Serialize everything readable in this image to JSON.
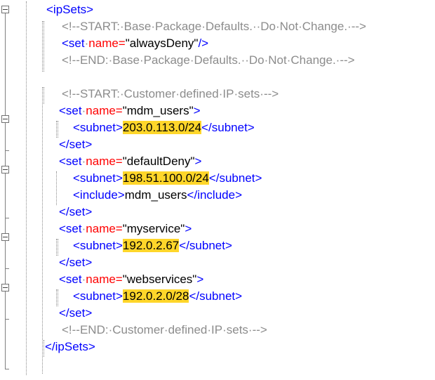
{
  "editor": {
    "lines": [
      {
        "name": "ipsets-open",
        "parts": [
          {
            "t": "tag",
            "v": "<ipSets>"
          }
        ]
      },
      {
        "name": "comment-start-base",
        "parts": [
          {
            "t": "cmt",
            "v": "<!--START:·Base·Package·Defaults.··Do·Not·Change.·-->"
          }
        ]
      },
      {
        "name": "set-alwaysdeny",
        "parts": [
          {
            "t": "tag",
            "v": "<set"
          },
          {
            "t": "cmt",
            "v": "·"
          },
          {
            "t": "attr",
            "v": "name="
          },
          {
            "t": "val",
            "v": "\"alwaysDeny\""
          },
          {
            "t": "tag",
            "v": "/>"
          }
        ]
      },
      {
        "name": "comment-end-base",
        "parts": [
          {
            "t": "cmt",
            "v": "<!--END:·Base·Package·Defaults.··Do·Not·Change.·-->"
          }
        ]
      },
      {
        "name": "blank",
        "parts": []
      },
      {
        "name": "comment-start-customer",
        "parts": [
          {
            "t": "cmt",
            "v": "<!--START:·Customer·defined·IP·sets·-->"
          }
        ]
      },
      {
        "name": "set-mdm-users",
        "parts": [
          {
            "t": "tag",
            "v": "<set"
          },
          {
            "t": "cmt",
            "v": "·"
          },
          {
            "t": "attr",
            "v": "name="
          },
          {
            "t": "val",
            "v": "\"mdm_users\""
          },
          {
            "t": "tag",
            "v": ">"
          }
        ]
      },
      {
        "name": "subnet-mdm",
        "parts": [
          {
            "t": "tag",
            "v": "<subnet>"
          },
          {
            "t": "hl",
            "v": "203.0.113.0/24"
          },
          {
            "t": "tag",
            "v": "</subnet>"
          }
        ]
      },
      {
        "name": "set-close",
        "parts": [
          {
            "t": "tag",
            "v": "</set>"
          }
        ]
      },
      {
        "name": "set-defaultdeny",
        "parts": [
          {
            "t": "tag",
            "v": "<set"
          },
          {
            "t": "cmt",
            "v": "·"
          },
          {
            "t": "attr",
            "v": "name="
          },
          {
            "t": "val",
            "v": "\"defaultDeny\""
          },
          {
            "t": "tag",
            "v": ">"
          }
        ]
      },
      {
        "name": "subnet-defaultdeny",
        "parts": [
          {
            "t": "tag",
            "v": "<subnet>"
          },
          {
            "t": "hl",
            "v": "198.51.100.0/24"
          },
          {
            "t": "tag",
            "v": "</subnet>"
          }
        ]
      },
      {
        "name": "include-mdm",
        "parts": [
          {
            "t": "tag",
            "v": "<include>"
          },
          {
            "t": "txt",
            "v": "mdm_users"
          },
          {
            "t": "tag",
            "v": "</include>"
          }
        ]
      },
      {
        "name": "set-close",
        "parts": [
          {
            "t": "tag",
            "v": "</set>"
          }
        ]
      },
      {
        "name": "set-myservice",
        "parts": [
          {
            "t": "tag",
            "v": "<set"
          },
          {
            "t": "cmt",
            "v": "·"
          },
          {
            "t": "attr",
            "v": "name="
          },
          {
            "t": "val",
            "v": "\"myservice\""
          },
          {
            "t": "tag",
            "v": ">"
          }
        ]
      },
      {
        "name": "subnet-myservice",
        "parts": [
          {
            "t": "tag",
            "v": "<subnet>"
          },
          {
            "t": "hl",
            "v": "192.0.2.67"
          },
          {
            "t": "tag",
            "v": "</subnet>"
          }
        ]
      },
      {
        "name": "set-close",
        "parts": [
          {
            "t": "tag",
            "v": "</set>"
          }
        ]
      },
      {
        "name": "set-webservices",
        "parts": [
          {
            "t": "tag",
            "v": "<set"
          },
          {
            "t": "cmt",
            "v": "·"
          },
          {
            "t": "attr",
            "v": "name="
          },
          {
            "t": "val",
            "v": "\"webservices\""
          },
          {
            "t": "tag",
            "v": ">"
          }
        ]
      },
      {
        "name": "subnet-webservices",
        "parts": [
          {
            "t": "tag",
            "v": "<subnet>"
          },
          {
            "t": "hl",
            "v": "192.0.2.0/28"
          },
          {
            "t": "tag",
            "v": "</subnet>"
          }
        ]
      },
      {
        "name": "set-close",
        "parts": [
          {
            "t": "tag",
            "v": "</set>"
          }
        ]
      },
      {
        "name": "comment-end-customer",
        "parts": [
          {
            "t": "cmt",
            "v": "<!--END:·Customer·defined·IP·sets·-->"
          }
        ]
      },
      {
        "name": "ipsets-close",
        "parts": [
          {
            "t": "tag",
            "v": "</ipSets>"
          }
        ]
      }
    ]
  }
}
